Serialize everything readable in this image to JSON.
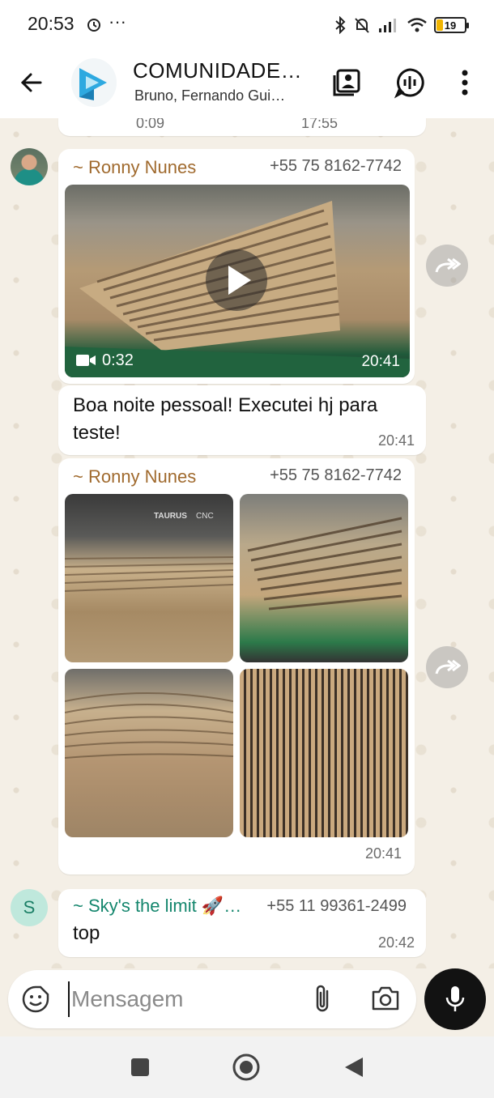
{
  "status_bar": {
    "time": "20:53",
    "more_indicator": "···",
    "battery_level": "19",
    "icons": [
      "alarm-icon",
      "bluetooth-icon",
      "muted-bell-icon",
      "signal-icon",
      "wifi-icon",
      "battery-icon"
    ]
  },
  "header": {
    "group_name": "COMUNIDADE…",
    "members": "Bruno, Fernando Gui…",
    "icons": [
      "back-arrow-icon",
      "media-gallery-icon",
      "voice-chat-icon",
      "more-vert-icon"
    ]
  },
  "messages": {
    "top_partial": {
      "left_time": "0:09",
      "right_time": "17:55"
    },
    "video_message": {
      "sender": "~ Ronny Nunes",
      "phone": "+55 75 8162-7742",
      "duration": "0:32",
      "time": "20:41"
    },
    "text_message": {
      "line1": "Boa noite pessoal! Executei hj para",
      "line2": "teste!",
      "time": "20:41"
    },
    "album_message": {
      "sender": "~ Ronny Nunes",
      "phone": "+55 75 8162-7742",
      "photo_count": 4,
      "sign_text": "TAURUS",
      "sign_suffix": "CNC",
      "time": "20:41"
    },
    "last_message": {
      "avatar_letter": "S",
      "sender": "~ Sky's the limit 🚀…",
      "phone": "+55 11 99361-2499",
      "text": "top",
      "time": "20:42"
    }
  },
  "composer": {
    "placeholder": "Mensagem",
    "icons": [
      "sticker-icon",
      "attach-icon",
      "camera-icon",
      "mic-icon"
    ]
  },
  "colors": {
    "chat_bg": "#f4efe6",
    "sender_brown": "#a06a2e",
    "sender_green": "#14866d",
    "accent_blue": "#2ea9e0"
  }
}
